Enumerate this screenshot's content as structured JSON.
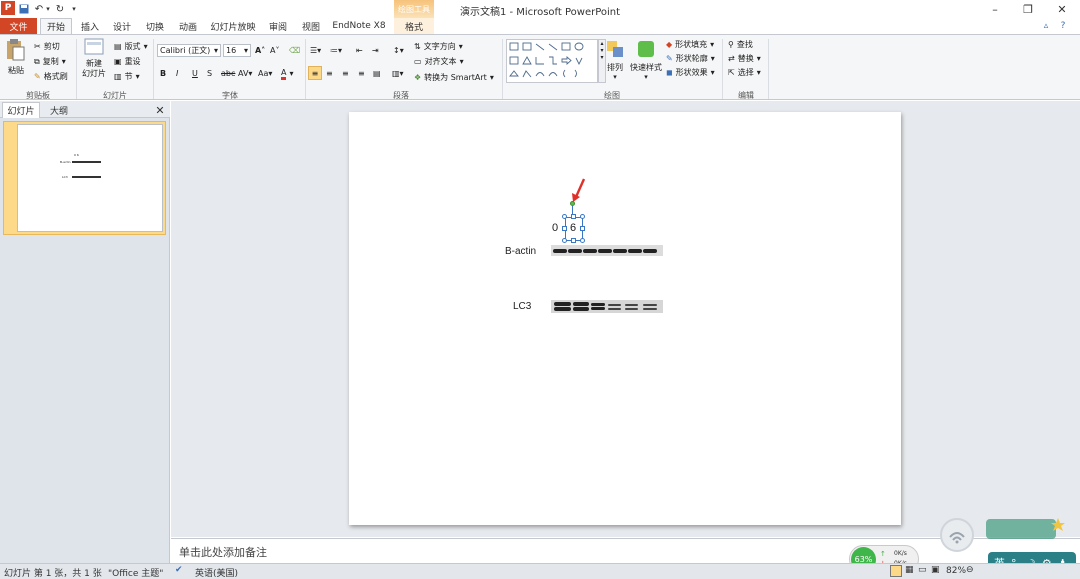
{
  "window": {
    "title": "演示文稿1 - Microsoft PowerPoint",
    "context_tab_title": "绘图工具"
  },
  "tabs": [
    "文件",
    "开始",
    "插入",
    "设计",
    "切换",
    "动画",
    "幻灯片放映",
    "审阅",
    "视图",
    "EndNote X8",
    "格式"
  ],
  "ribbon": {
    "clipboard": {
      "paste": "粘贴",
      "cut": "剪切",
      "copy": "复制",
      "format_painter": "格式刷",
      "label": "剪贴板"
    },
    "slides": {
      "new_slide_1": "新建",
      "new_slide_2": "幻灯片",
      "layout": "版式",
      "reset": "重设",
      "section": "节",
      "label": "幻灯片"
    },
    "font": {
      "family": "Calibri (正文)",
      "size": "16",
      "label": "字体"
    },
    "paragraph": {
      "text_direction": "文字方向",
      "align_text": "对齐文本",
      "smartart": "转换为 SmartArt",
      "label": "段落"
    },
    "drawing": {
      "arrange": "排列",
      "quick_styles": "快速样式",
      "shape_fill": "形状填充",
      "shape_outline": "形状轮廓",
      "shape_effects": "形状效果",
      "label": "绘图"
    },
    "editing": {
      "find": "查找",
      "replace": "替换",
      "select": "选择",
      "label": "编辑"
    }
  },
  "side_panel": {
    "tab_slides": "幻灯片",
    "tab_outline": "大纲",
    "slide_number": "1"
  },
  "slide": {
    "text_box_value_0": "0",
    "text_box_value_6": "6",
    "label_bactin": "B-actin",
    "label_lc3": "LC3"
  },
  "notes": {
    "placeholder": "单击此处添加备注"
  },
  "status": {
    "slide_info": "幻灯片 第 1 张，共 1 张",
    "theme": "\"Office 主题\"",
    "language": "英语(美国)",
    "zoom": "82%",
    "net_percent": "63%",
    "net_up": "0K/s",
    "net_down": "0K/s",
    "ime": "英"
  },
  "colors": {
    "accent": "#d24625",
    "arrow": "#e0302a",
    "selection": "#3a78c6"
  }
}
